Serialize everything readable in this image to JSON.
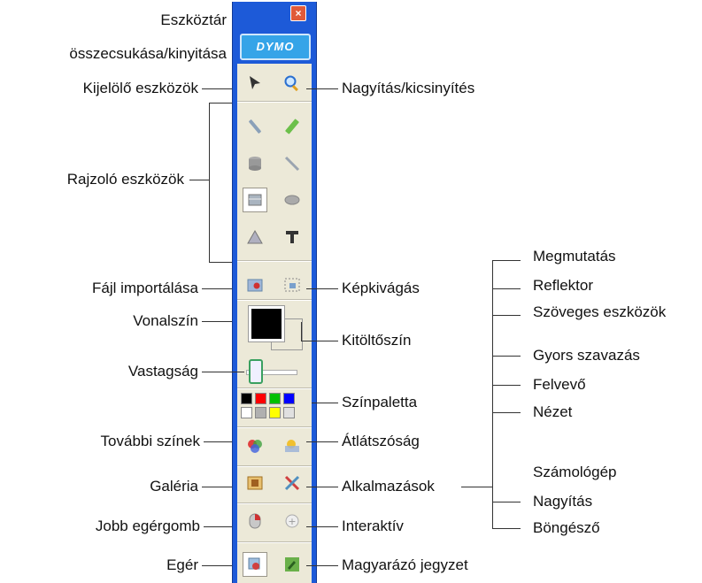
{
  "labels": {
    "toolbar_toggle": "Eszköztár\nösszecsukása/kinyitása",
    "toolbar_toggle_line1": "Eszköztár",
    "toolbar_toggle_line2": "összecsukása/kinyitása",
    "select_tools": "Kijelölő eszközök",
    "zoom": "Nagyítás/kicsinyítés",
    "draw_tools": "Rajzoló eszközök",
    "import_file": "Fájl importálása",
    "crop": "Képkivágás",
    "line_color": "Vonalszín",
    "fill_color": "Kitöltőszín",
    "thickness": "Vastagság",
    "palette": "Színpaletta",
    "more_colors": "További színek",
    "transparency": "Átlátszóság",
    "gallery": "Galéria",
    "applications": "Alkalmazások",
    "right_click": "Jobb egérgomb",
    "interactive": "Interaktív",
    "mouse": "Egér",
    "annotation": "Magyarázó jegyzet"
  },
  "applications_list": [
    "Megmutatás",
    "Reflektor",
    "Szöveges eszközök",
    "Gyors szavazás",
    "Felvevő",
    "Nézet",
    "Számológép",
    "Nagyítás",
    "Böngésző"
  ],
  "toolbar": {
    "logo": "DYMO",
    "close": "×"
  },
  "palette_colors": [
    "#000000",
    "#ff0000",
    "#00c000",
    "#0000ff",
    "#ffffff",
    "#b0b0b0",
    "#ffff00",
    "#e0e0e0"
  ],
  "icons": {
    "select": "pointer-arrow-icon",
    "zoom": "magnifier-icon",
    "pen": "pen-icon",
    "highlighter": "highlighter-icon",
    "eraser": "eraser-icon",
    "line": "line-icon",
    "shape": "shape-icon",
    "fill": "fill-icon",
    "triangle": "triangle-icon",
    "text": "text-icon",
    "import": "import-icon",
    "crop": "crop-icon",
    "more_colors": "color-wheel-icon",
    "transparency": "transparency-icon",
    "gallery": "gallery-icon",
    "applications": "applications-icon",
    "right_click": "right-click-icon",
    "interactive": "interactive-icon",
    "mouse": "mouse-icon",
    "annotation": "annotation-icon"
  }
}
